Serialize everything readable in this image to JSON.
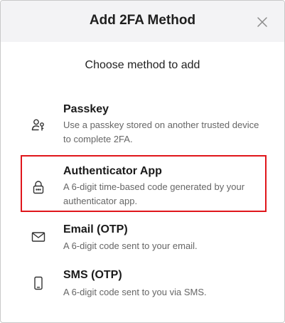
{
  "dialog": {
    "title": "Add 2FA Method",
    "subtitle": "Choose method to add",
    "close_icon": "close-icon"
  },
  "methods": [
    {
      "id": "passkey",
      "name": "Passkey",
      "description": "Use a passkey stored on another trusted device to complete 2FA.",
      "icon": "person-key-icon"
    },
    {
      "id": "authenticator",
      "name": "Authenticator App",
      "description": "A 6-digit time-based code generated by your authenticator app.",
      "icon": "lock-icon",
      "highlighted": true,
      "highlight_color": "#e0161b"
    },
    {
      "id": "email",
      "name": "Email (OTP)",
      "description": "A 6-digit code sent to your email.",
      "icon": "envelope-icon"
    },
    {
      "id": "sms",
      "name": "SMS (OTP)",
      "description": "A 6-digit code sent to you via SMS.",
      "icon": "phone-icon"
    }
  ]
}
